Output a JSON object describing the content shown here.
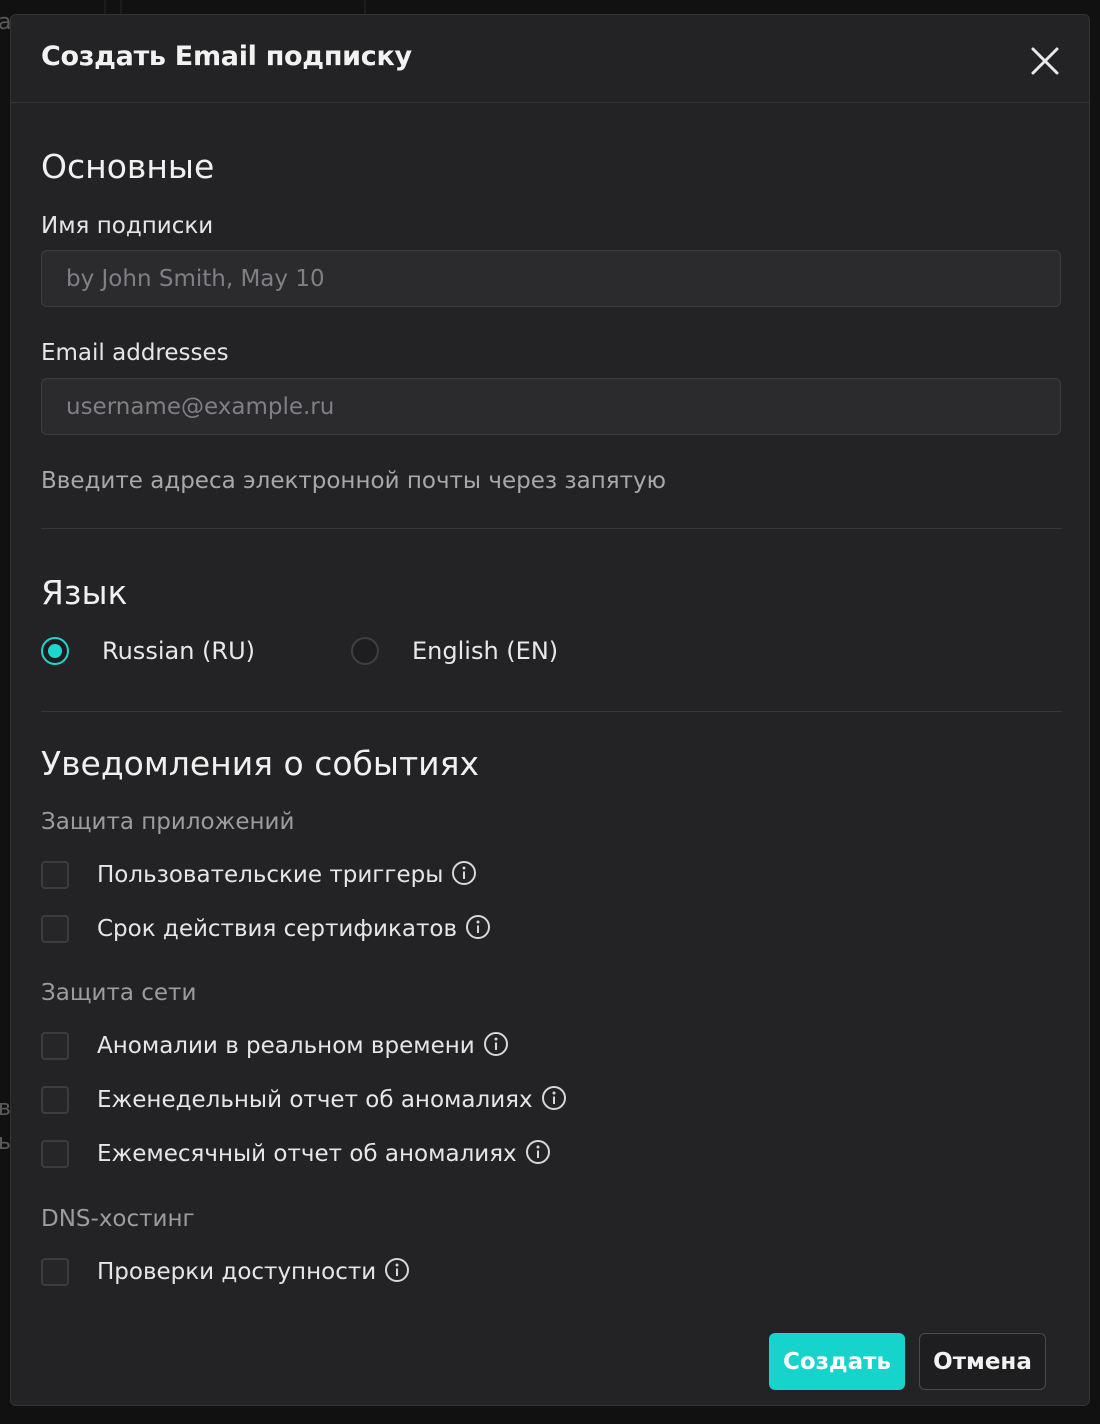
{
  "background": {
    "fragments": [
      "a",
      "в",
      "ь"
    ]
  },
  "modal": {
    "title": "Создать Email подписку",
    "close_icon": "close-icon"
  },
  "basics": {
    "section_title": "Основные",
    "name_label": "Имя подписки",
    "name_placeholder": "by John Smith, May 10",
    "name_value": "",
    "emails_label": "Email addresses",
    "emails_placeholder": "username@example.ru",
    "emails_value": "",
    "emails_hint": "Введите адреса электронной почты через запятую"
  },
  "language": {
    "section_title": "Язык",
    "options": [
      {
        "label": "Russian (RU)",
        "selected": true
      },
      {
        "label": "English (EN)",
        "selected": false
      }
    ]
  },
  "notifications": {
    "section_title": "Уведомления о событиях",
    "groups": [
      {
        "label": "Защита приложений",
        "items": [
          {
            "label": "Пользовательские триггеры",
            "checked": false,
            "info_icon": "info-icon"
          },
          {
            "label": "Срок действия сертификатов",
            "checked": false,
            "info_icon": "info-icon"
          }
        ]
      },
      {
        "label": "Защита сети",
        "items": [
          {
            "label": "Аномалии в реальном времени",
            "checked": false,
            "info_icon": "info-icon"
          },
          {
            "label": "Еженедельный отчет об аномалиях",
            "checked": false,
            "info_icon": "info-icon"
          },
          {
            "label": "Ежемесячный отчет об аномалиях",
            "checked": false,
            "info_icon": "info-icon"
          }
        ]
      },
      {
        "label": "DNS-хостинг",
        "items": [
          {
            "label": "Проверки доступности",
            "checked": false,
            "info_icon": "info-icon"
          }
        ]
      }
    ]
  },
  "footer": {
    "create_label": "Создать",
    "cancel_label": "Отмена"
  },
  "colors": {
    "accent": "#16d3cc",
    "modal_bg": "#232325",
    "input_bg": "#2b2b2e"
  }
}
